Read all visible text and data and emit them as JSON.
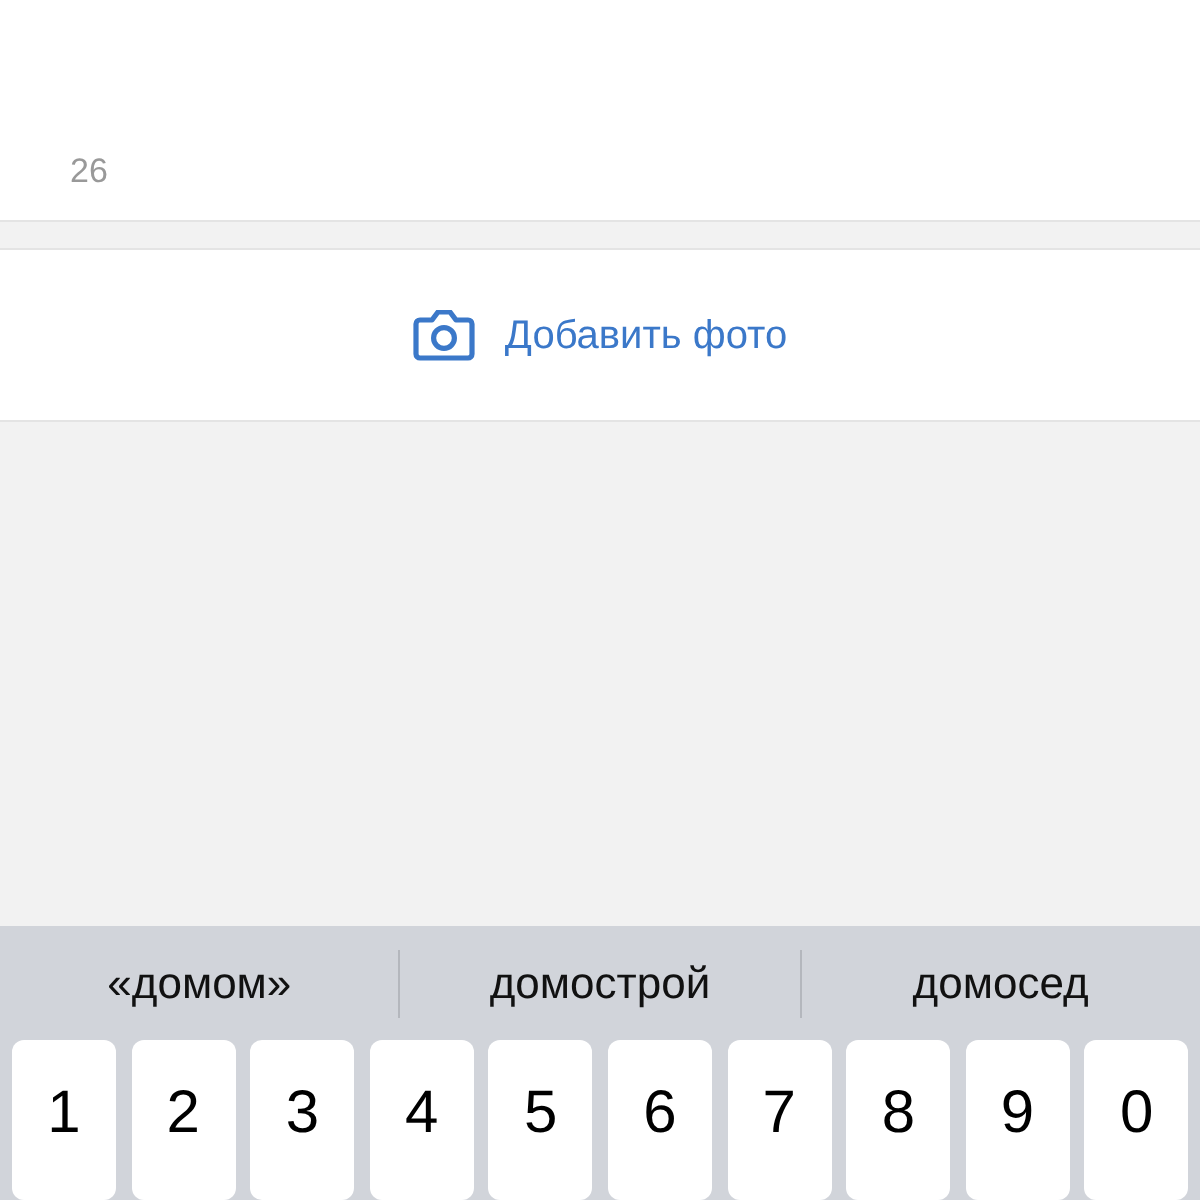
{
  "counter": "26",
  "add_photo": {
    "label": "Добавить фото"
  },
  "keyboard": {
    "suggestions": [
      "«домом»",
      "домострой",
      "домосед"
    ],
    "keys": [
      "1",
      "2",
      "3",
      "4",
      "5",
      "6",
      "7",
      "8",
      "9",
      "0"
    ]
  }
}
